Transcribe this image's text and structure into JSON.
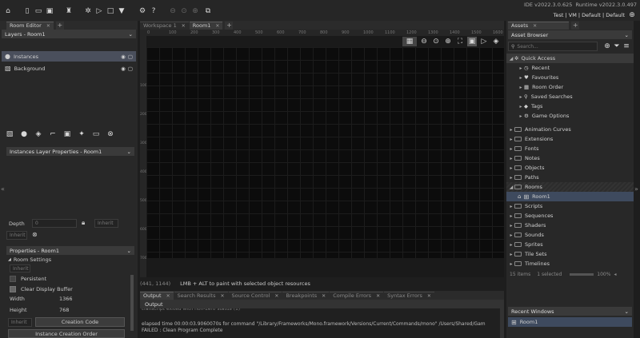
{
  "ide_version": "IDE v2022.3.0.625",
  "runtime_version": "Runtime v2022.3.0.497",
  "config": "Test | VM | Default | Default",
  "workspace_tabs": [
    {
      "label": "Workspace 1",
      "active": false
    },
    {
      "label": "Room1",
      "active": true
    }
  ],
  "room_editor": {
    "tab_label": "Room Editor",
    "layers_header": "Layers - Room1",
    "layers": [
      {
        "name": "Instances",
        "selected": true
      },
      {
        "name": "Background",
        "selected": false
      }
    ],
    "layer_props_header": "Instances Layer Properties - Room1",
    "depth_label": "Depth",
    "depth_value": "0",
    "inherit_label": "Inherit",
    "properties_header": "Properties - Room1",
    "room_settings_label": "Room Settings",
    "persistent_label": "Persistent",
    "clear_display_label": "Clear Display Buffer",
    "width_label": "Width",
    "width_value": "1366",
    "height_label": "Height",
    "height_value": "768",
    "creation_code_label": "Creation Code",
    "instance_creation_order_label": "Instance Creation Order"
  },
  "ruler_ticks": [
    "0",
    "100",
    "200",
    "300",
    "400",
    "500",
    "600",
    "700",
    "800",
    "900",
    "1000",
    "1100",
    "1200",
    "1300",
    "1400",
    "1500",
    "1600"
  ],
  "ruler_vticks": [
    "100",
    "200",
    "300",
    "400",
    "500",
    "600",
    "700"
  ],
  "status": {
    "coords": "(441, 1144)",
    "hint": "LMB + ALT to paint with selected object resources"
  },
  "output": {
    "tabs": [
      "Output",
      "Search Results",
      "Source Control",
      "Breakpoints",
      "Compile Errors",
      "Syntax Errors"
    ],
    "sub_label": "Output",
    "lines": [
      "transcript exited with non-zero status (1)",
      "elapsed time 00:00:03.9060070s for command \"/Library/Frameworks/Mono.framework/Versions/Current/Commands/mono\" /Users/Shared/Gam",
      "FAILED : Clean Program Complete"
    ]
  },
  "assets": {
    "tab_label": "Assets",
    "browser_label": "Asset Browser",
    "search_placeholder": "Search...",
    "quick_access_label": "Quick Access",
    "quick_items": [
      {
        "label": "Recent",
        "icon": "clock-icon",
        "glyph": "◷"
      },
      {
        "label": "Favourites",
        "icon": "heart-icon",
        "glyph": "♥"
      },
      {
        "label": "Room Order",
        "icon": "room-order-icon",
        "glyph": "▦"
      },
      {
        "label": "Saved Searches",
        "icon": "search-icon",
        "glyph": "⚲"
      },
      {
        "label": "Tags",
        "icon": "tag-icon",
        "glyph": "◆"
      },
      {
        "label": "Game Options",
        "icon": "gear-icon",
        "glyph": "⚙"
      }
    ],
    "folders_a": [
      "Animation Curves",
      "Extensions",
      "Fonts",
      "Notes",
      "Objects",
      "Paths"
    ],
    "rooms_label": "Rooms",
    "room1_label": "Room1",
    "folders_b": [
      "Scripts",
      "Sequences",
      "Shaders",
      "Sounds",
      "Sprites",
      "Tile Sets",
      "Timelines"
    ],
    "items_count": "15 items",
    "selected_count": "1 selected",
    "zoom_label": "100%",
    "recent_windows_label": "Recent Windows",
    "recent_room_label": "Room1"
  },
  "colors": {
    "selection": "#4a4f5c",
    "room_selected": "#3e4a5e"
  }
}
